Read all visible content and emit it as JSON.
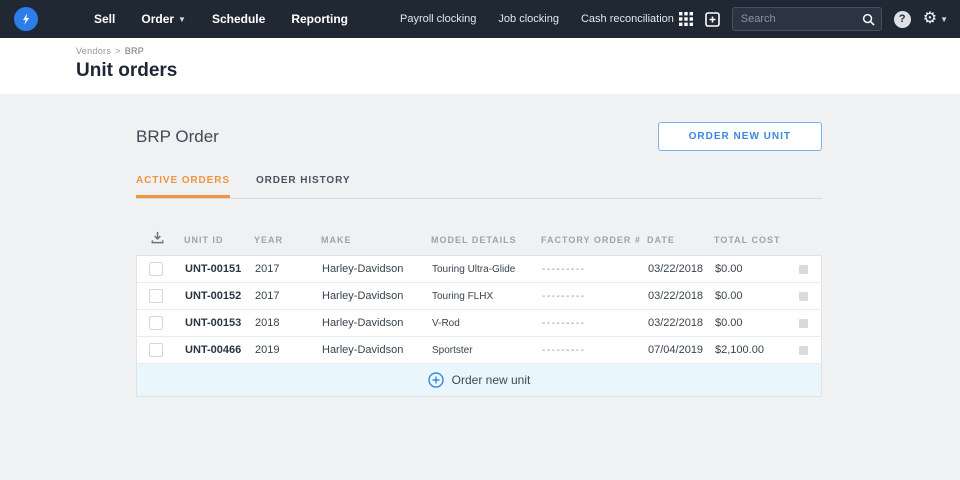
{
  "colors": {
    "navbar_bg": "#202834",
    "accent_blue": "#3b87e0",
    "accent_orange": "#f0953f",
    "page_bg": "#f0f1f3",
    "footer_row_bg": "#e9f6fb"
  },
  "navbar": {
    "nav_items": [
      {
        "label": "Sell"
      },
      {
        "label": "Order"
      },
      {
        "label": "Schedule"
      },
      {
        "label": "Reporting"
      }
    ],
    "secondary_items": [
      {
        "label": "Payroll clocking"
      },
      {
        "label": "Job clocking"
      },
      {
        "label": "Cash reconciliation"
      }
    ],
    "search": {
      "placeholder": "Search"
    },
    "help_label": "?"
  },
  "header": {
    "breadcrumb": {
      "parent": "Vendors",
      "separator": ">",
      "current": "BRP"
    },
    "title": "Unit orders"
  },
  "content": {
    "section_title": "BRP Order",
    "order_new_unit_button": "ORDER NEW UNIT",
    "tabs": [
      {
        "label": "ACTIVE ORDERS"
      },
      {
        "label": "ORDER HISTORY"
      }
    ]
  },
  "table": {
    "columns": [
      "UNIT ID",
      "YEAR",
      "MAKE",
      "MODEL DETAILS",
      "FACTORY ORDER #",
      "DATE",
      "TOTAL COST"
    ],
    "rows": [
      {
        "unit_id": "UNT-00151",
        "year": "2017",
        "make": "Harley-Davidson",
        "model_details": "Touring Ultra-Glide",
        "factory_order": "---------",
        "date": "03/22/2018",
        "total_cost": "$0.00"
      },
      {
        "unit_id": "UNT-00152",
        "year": "2017",
        "make": "Harley-Davidson",
        "model_details": "Touring FLHX",
        "factory_order": "---------",
        "date": "03/22/2018",
        "total_cost": "$0.00"
      },
      {
        "unit_id": "UNT-00153",
        "year": "2018",
        "make": "Harley-Davidson",
        "model_details": "V-Rod",
        "factory_order": "---------",
        "date": "03/22/2018",
        "total_cost": "$0.00"
      },
      {
        "unit_id": "UNT-00466",
        "year": "2019",
        "make": "Harley-Davidson",
        "model_details": "Sportster",
        "factory_order": "---------",
        "date": "07/04/2019",
        "total_cost": "$2,100.00"
      }
    ],
    "footer_action": "Order new unit"
  }
}
